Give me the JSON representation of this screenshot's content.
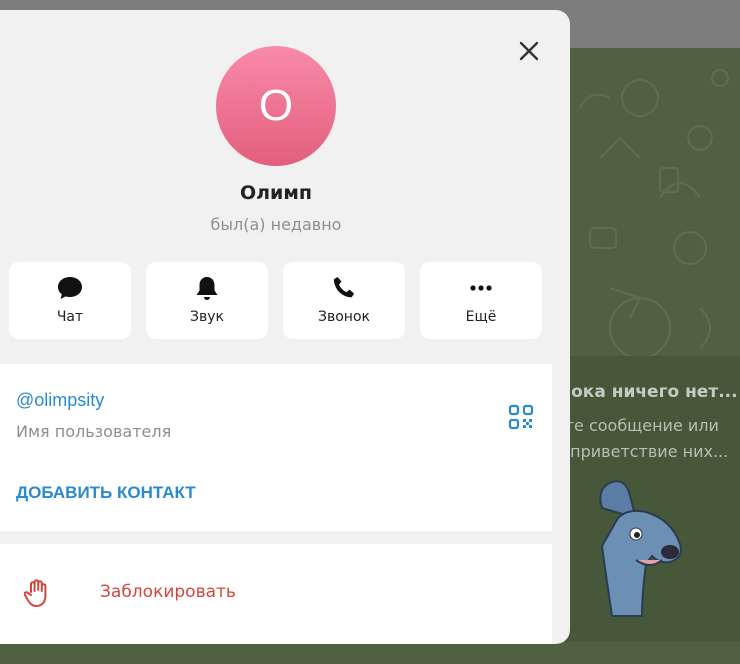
{
  "profile": {
    "avatar_letter": "О",
    "name": "Олимп",
    "status": "был(а) недавно"
  },
  "actions": [
    {
      "label": "Чат",
      "icon": "chat-bubble-icon"
    },
    {
      "label": "Звук",
      "icon": "bell-icon"
    },
    {
      "label": "Звонок",
      "icon": "phone-icon"
    },
    {
      "label": "Ещё",
      "icon": "more-dots-icon"
    }
  ],
  "info": {
    "username": "@olimpsity",
    "username_label": "Имя пользователя",
    "add_contact": "ДОБАВИТЬ КОНТАКТ"
  },
  "block": {
    "label": "Заблокировать",
    "icon": "hand-stop-icon"
  },
  "background_chat": {
    "empty_title": "...пока ничего нет...",
    "empty_line1": "...ьте сообщение или",
    "empty_line2": "...а приветствие них..."
  },
  "colors": {
    "accent": "#2a8ad0",
    "danger": "#d4453f",
    "avatar_top": "#f98aa9",
    "avatar_bottom": "#e25f7c"
  }
}
